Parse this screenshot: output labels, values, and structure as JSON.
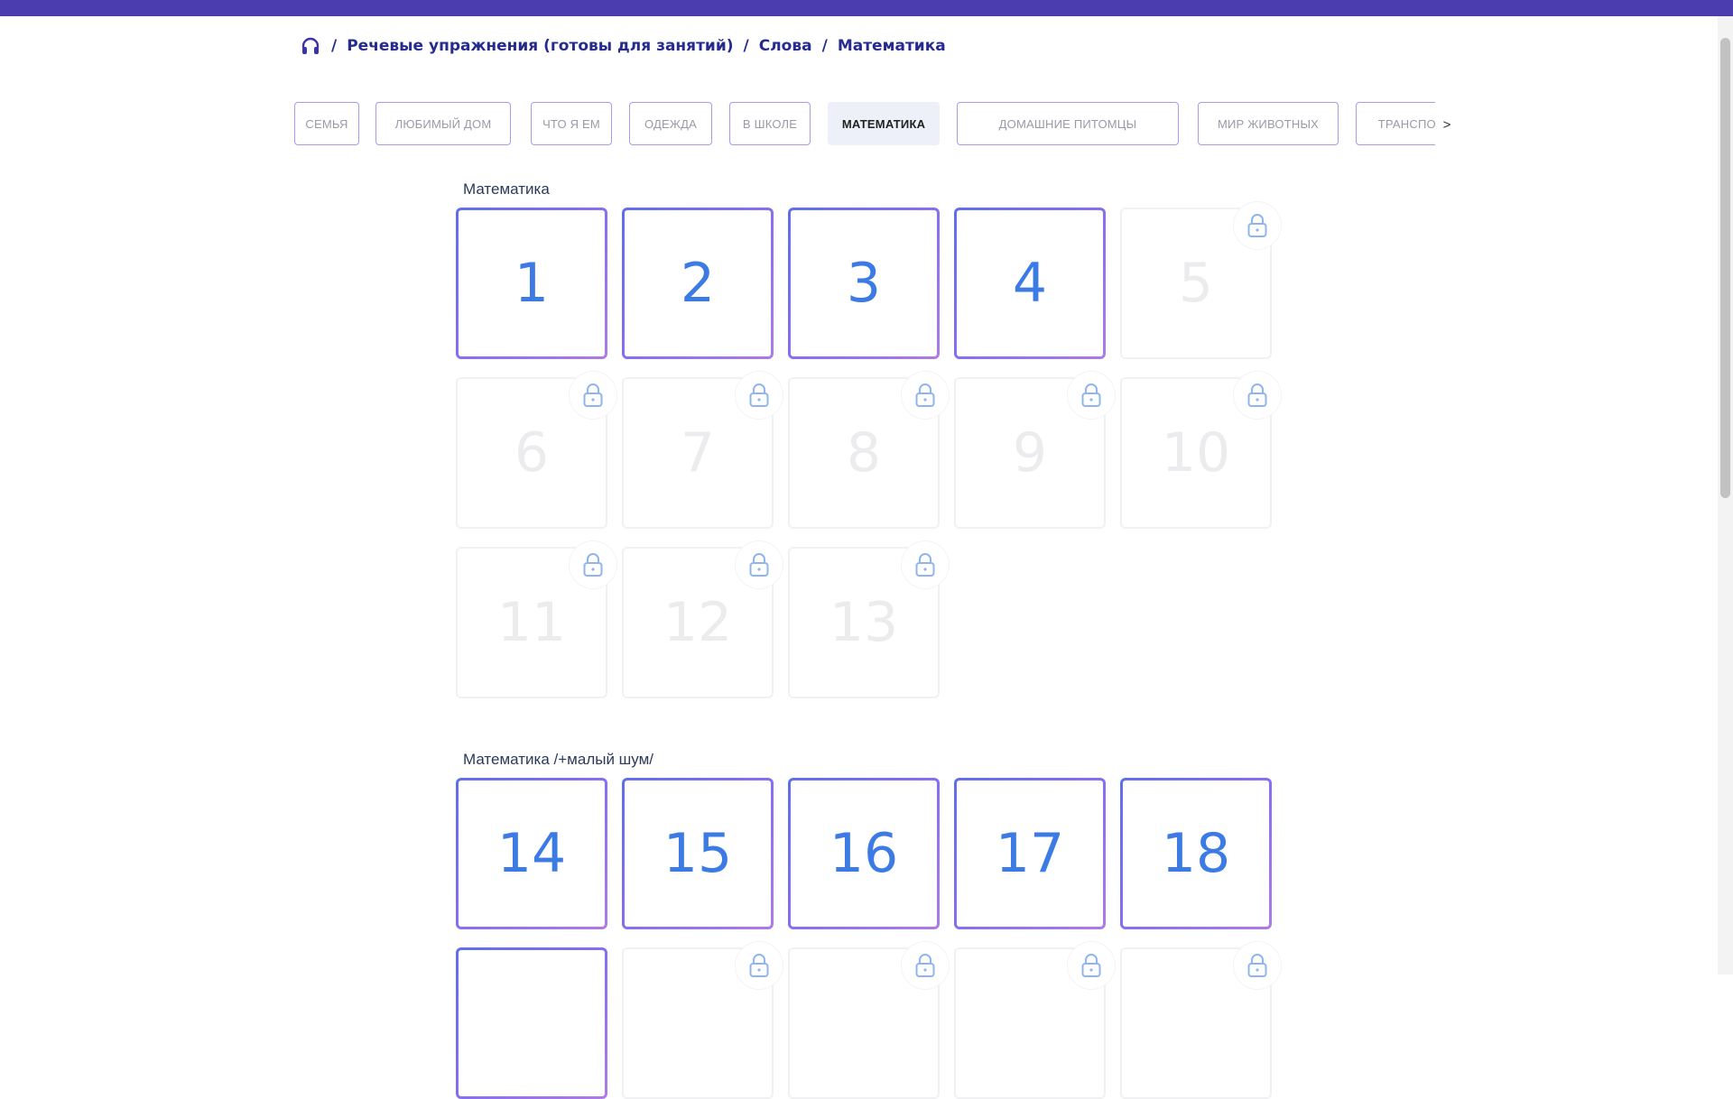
{
  "breadcrumb": {
    "home_icon": "headphones-icon",
    "separator": "/",
    "items": [
      "Речевые упражнения (готовы для занятий)",
      "Слова",
      "Математика"
    ]
  },
  "tabs": [
    {
      "label": "СЕМЬЯ",
      "active": false
    },
    {
      "label": "ЛЮБИМЫЙ ДОМ",
      "active": false
    },
    {
      "label": "ЧТО Я ЕМ",
      "active": false
    },
    {
      "label": "ОДЕЖДА",
      "active": false
    },
    {
      "label": "В ШКОЛЕ",
      "active": false
    },
    {
      "label": "МАТЕМАТИКА",
      "active": true
    },
    {
      "label": "ДОМАШНИЕ ПИТОМЦЫ",
      "active": false
    },
    {
      "label": "МИР ЖИВОТНЫХ",
      "active": false
    },
    {
      "label": "ТРАНСПОРТ",
      "active": false
    }
  ],
  "tabs_next_label": ">",
  "sections": [
    {
      "title": "Математика",
      "cards": [
        {
          "label": "1",
          "locked": false
        },
        {
          "label": "2",
          "locked": false
        },
        {
          "label": "3",
          "locked": false
        },
        {
          "label": "4",
          "locked": false
        },
        {
          "label": "5",
          "locked": true
        },
        {
          "label": "6",
          "locked": true
        },
        {
          "label": "7",
          "locked": true
        },
        {
          "label": "8",
          "locked": true
        },
        {
          "label": "9",
          "locked": true
        },
        {
          "label": "10",
          "locked": true
        },
        {
          "label": "11",
          "locked": true
        },
        {
          "label": "12",
          "locked": true
        },
        {
          "label": "13",
          "locked": true
        }
      ]
    },
    {
      "title": "Математика /+малый шум/",
      "cards": [
        {
          "label": "14",
          "locked": false
        },
        {
          "label": "15",
          "locked": false
        },
        {
          "label": "16",
          "locked": false
        },
        {
          "label": "17",
          "locked": false
        },
        {
          "label": "18",
          "locked": false
        },
        {
          "label": "",
          "locked": false
        },
        {
          "label": "",
          "locked": true
        },
        {
          "label": "",
          "locked": true
        },
        {
          "label": "",
          "locked": true
        },
        {
          "label": "",
          "locked": true
        }
      ]
    }
  ],
  "colors": {
    "topbar": "#4b3cb0",
    "breadcrumb_text": "#262b8f",
    "card_number": "#3c7be3",
    "card_border_start": "#5f6fe8",
    "card_border_end": "#b07ae6",
    "tab_border": "#a69aec",
    "lock_icon": "#8fb4ee"
  }
}
